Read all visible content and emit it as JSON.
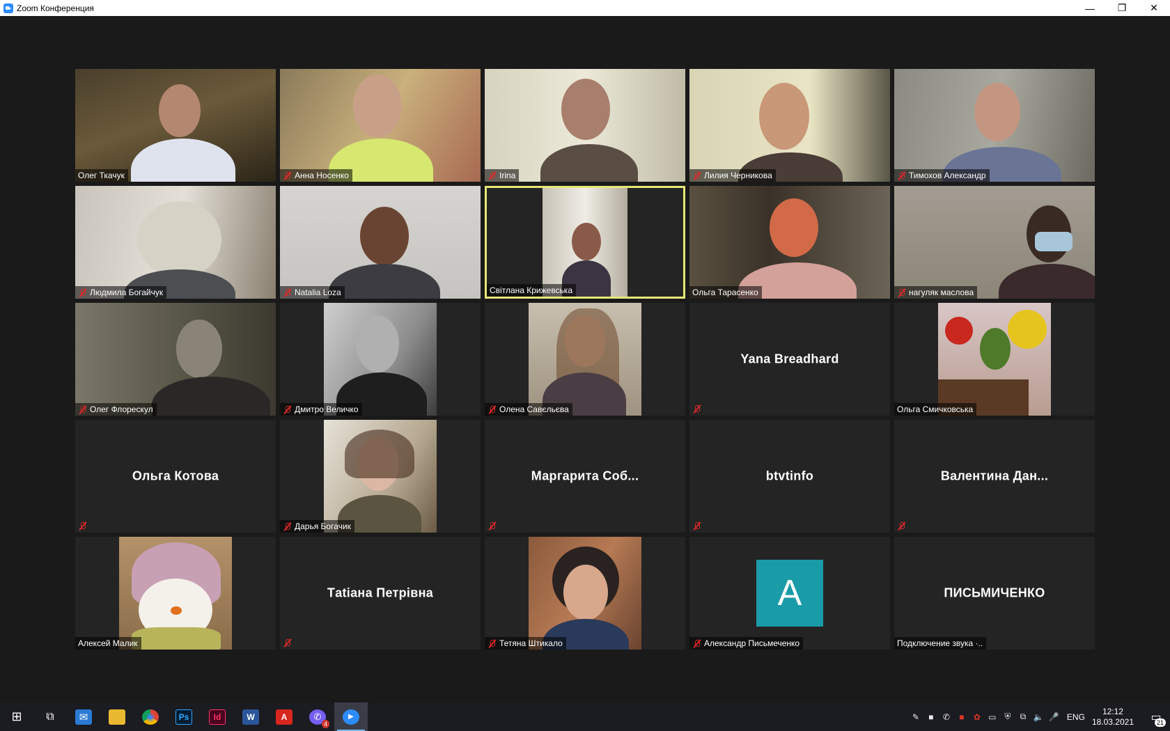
{
  "window": {
    "title": "Zoom Конференция",
    "minimize": "—",
    "restore": "❐",
    "close": "✕"
  },
  "participants": {
    "p1": {
      "name": "Олег Ткачук"
    },
    "p2": {
      "name": "Анна Носенко"
    },
    "p3": {
      "name": "Irina"
    },
    "p4": {
      "name": "Лилия Черникова"
    },
    "p5": {
      "name": "Тимохов Александр"
    },
    "p6": {
      "name": "Людмила Богайчук"
    },
    "p7": {
      "name": "Natalia Loza"
    },
    "p8": {
      "name": "Світлана Крижевська"
    },
    "p9": {
      "name": "Ольга Тарасенко"
    },
    "p10": {
      "name": "нагуляк маслова"
    },
    "p11": {
      "name": "Олег Флорескул"
    },
    "p12": {
      "name": "Дмитро Величко"
    },
    "p13": {
      "name": "Олена Савєльєва"
    },
    "p14": {
      "display": "Yana Breadhard"
    },
    "p15": {
      "name": "Ольга Смичковська"
    },
    "p16": {
      "display": "Ольга Котова"
    },
    "p17": {
      "name": "Дарья Богачик"
    },
    "p18": {
      "display": "Маргарита  Соб..."
    },
    "p19": {
      "display": "btvtinfo"
    },
    "p20": {
      "display": "Валентина  Дан..."
    },
    "p21": {
      "name": "Алексей Малик"
    },
    "p22": {
      "display": "Тatіана Петрівна"
    },
    "p23": {
      "name": "Тетяна Штикало"
    },
    "p24": {
      "name": "Александр Письмеченко",
      "avatar_letter": "A"
    },
    "p25": {
      "display": "ПИСЬМИЧЕНКО",
      "status": "Подключение звука ·.."
    }
  },
  "taskbar": {
    "items": [
      {
        "icon": "windows-start-icon",
        "label": "⊞"
      },
      {
        "icon": "task-view-icon",
        "label": "⧉"
      },
      {
        "icon": "mail-icon",
        "label": "✉"
      },
      {
        "icon": "file-explorer-icon",
        "label": "▬"
      },
      {
        "icon": "chrome-icon",
        "label": "◉"
      },
      {
        "icon": "photoshop-icon",
        "label": "Ps"
      },
      {
        "icon": "indesign-icon",
        "label": "Id"
      },
      {
        "icon": "word-icon",
        "label": "W"
      },
      {
        "icon": "acrobat-icon",
        "label": "A"
      },
      {
        "icon": "viber-icon",
        "label": "✆",
        "badge": "4"
      },
      {
        "icon": "zoom-icon",
        "label": "▶"
      }
    ],
    "lang": "ENG",
    "time": "12:12",
    "date": "18.03.2021",
    "notifications": "21"
  },
  "colors": {
    "active_speaker": "#e6e878",
    "avatar_bg": "#1a9ca8",
    "mute": "#e02828"
  }
}
